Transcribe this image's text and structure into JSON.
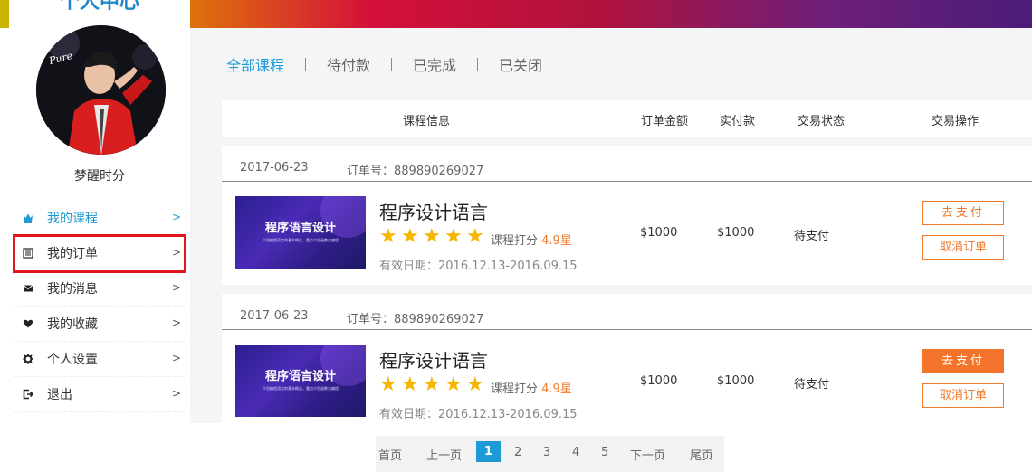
{
  "sidebar": {
    "title": "个人中心",
    "username": "梦醒时分",
    "avatar_text": "Pure",
    "menu": [
      {
        "label": "我的课程",
        "icon": "crown-icon",
        "arrow": ">"
      },
      {
        "label": "我的订单",
        "icon": "list-icon",
        "arrow": ">"
      },
      {
        "label": "我的消息",
        "icon": "envelope-icon",
        "arrow": ">"
      },
      {
        "label": "我的收藏",
        "icon": "heart-icon",
        "arrow": ">"
      },
      {
        "label": "个人设置",
        "icon": "gear-icon",
        "arrow": ">"
      },
      {
        "label": "退出",
        "icon": "logout-icon",
        "arrow": ">"
      }
    ]
  },
  "tabs": [
    "全部课程",
    "待付款",
    "已完成",
    "已关闭"
  ],
  "table_headers": {
    "course_info": "课程信息",
    "order_amount": "订单金额",
    "paid_amount": "实付款",
    "status": "交易状态",
    "actions": "交易操作"
  },
  "orders": [
    {
      "date": "2017-06-23",
      "order_no": "订单号：889890269027",
      "thumb_title": "程序语言设计",
      "thumb_subtitle": "介绍编程语言的基本概念，重点介绍函数式编程",
      "course_name": "程序设计语言",
      "rating_label": "课程打分",
      "rating_value": "4.9星",
      "stars": 5,
      "valid": "有效日期：2016.12.13-2016.09.15",
      "amount": "$1000",
      "paid": "$1000",
      "status": "待支付",
      "pay_label": "去支付",
      "cancel_label": "取消订单"
    },
    {
      "date": "2017-06-23",
      "order_no": "订单号：889890269027",
      "thumb_title": "程序语言设计",
      "thumb_subtitle": "介绍编程语言的基本概念，重点介绍函数式编程",
      "course_name": "程序设计语言",
      "rating_label": "课程打分",
      "rating_value": "4.9星",
      "stars": 5,
      "valid": "有效日期：2016.12.13-2016.09.15",
      "amount": "$1000",
      "paid": "$1000",
      "status": "待支付",
      "pay_label": "去支付",
      "cancel_label": "取消订单"
    }
  ],
  "pagination": {
    "first": "首页",
    "prev": "上一页",
    "pages": [
      "1",
      "2",
      "3",
      "4",
      "5"
    ],
    "current": "1",
    "next": "下一页",
    "last": "尾页"
  },
  "colors": {
    "accent": "#1e9ad6",
    "orange": "#f07a2b",
    "star": "#f5b600",
    "highlight": "#e1161f"
  }
}
